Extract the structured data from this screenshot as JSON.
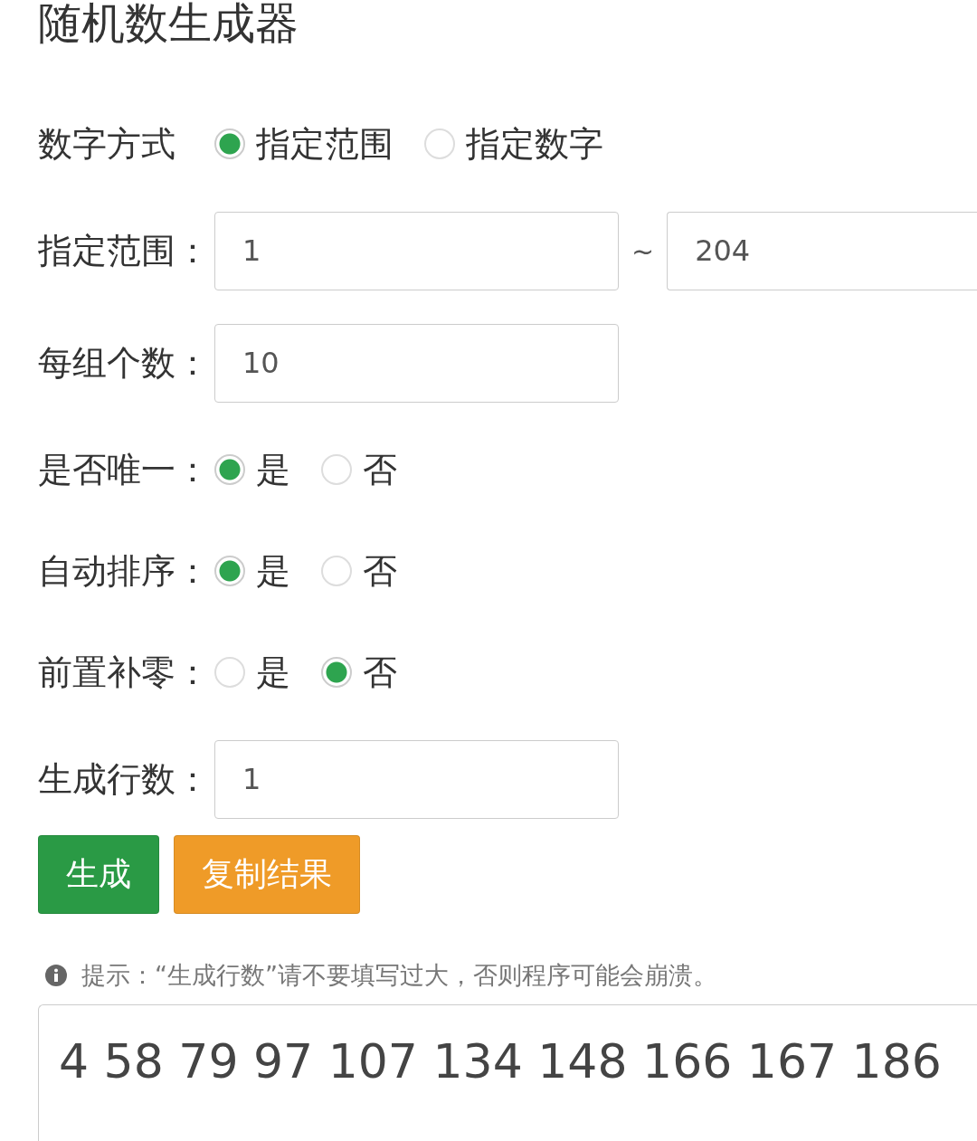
{
  "title": "随机数生成器",
  "rows": [
    {
      "kind": "radio",
      "label": "数字方式",
      "options": [
        {
          "label": "指定范围",
          "selected": true
        },
        {
          "label": "指定数字",
          "selected": false
        }
      ]
    },
    {
      "kind": "range",
      "label": "指定范围：",
      "from": "1",
      "separator": "~",
      "to": "204"
    },
    {
      "kind": "input",
      "label": "每组个数：",
      "value": "10"
    },
    {
      "kind": "radio",
      "label": "是否唯一：",
      "options": [
        {
          "label": "是",
          "selected": true
        },
        {
          "label": "否",
          "selected": false
        }
      ]
    },
    {
      "kind": "radio",
      "label": "自动排序：",
      "options": [
        {
          "label": "是",
          "selected": true
        },
        {
          "label": "否",
          "selected": false
        }
      ]
    },
    {
      "kind": "radio",
      "label": "前置补零：",
      "options": [
        {
          "label": "是",
          "selected": false
        },
        {
          "label": "否",
          "selected": true
        }
      ]
    },
    {
      "kind": "input",
      "label": "生成行数：",
      "value": "1"
    }
  ],
  "buttons": [
    {
      "label": "生成",
      "kind": "primary"
    },
    {
      "label": "复制结果",
      "kind": "warning"
    }
  ],
  "hint": "提示：“生成行数”请不要填写过大，否则程序可能会崩溃。",
  "result": "4 58 79 97 107 134 148 166 167 186"
}
